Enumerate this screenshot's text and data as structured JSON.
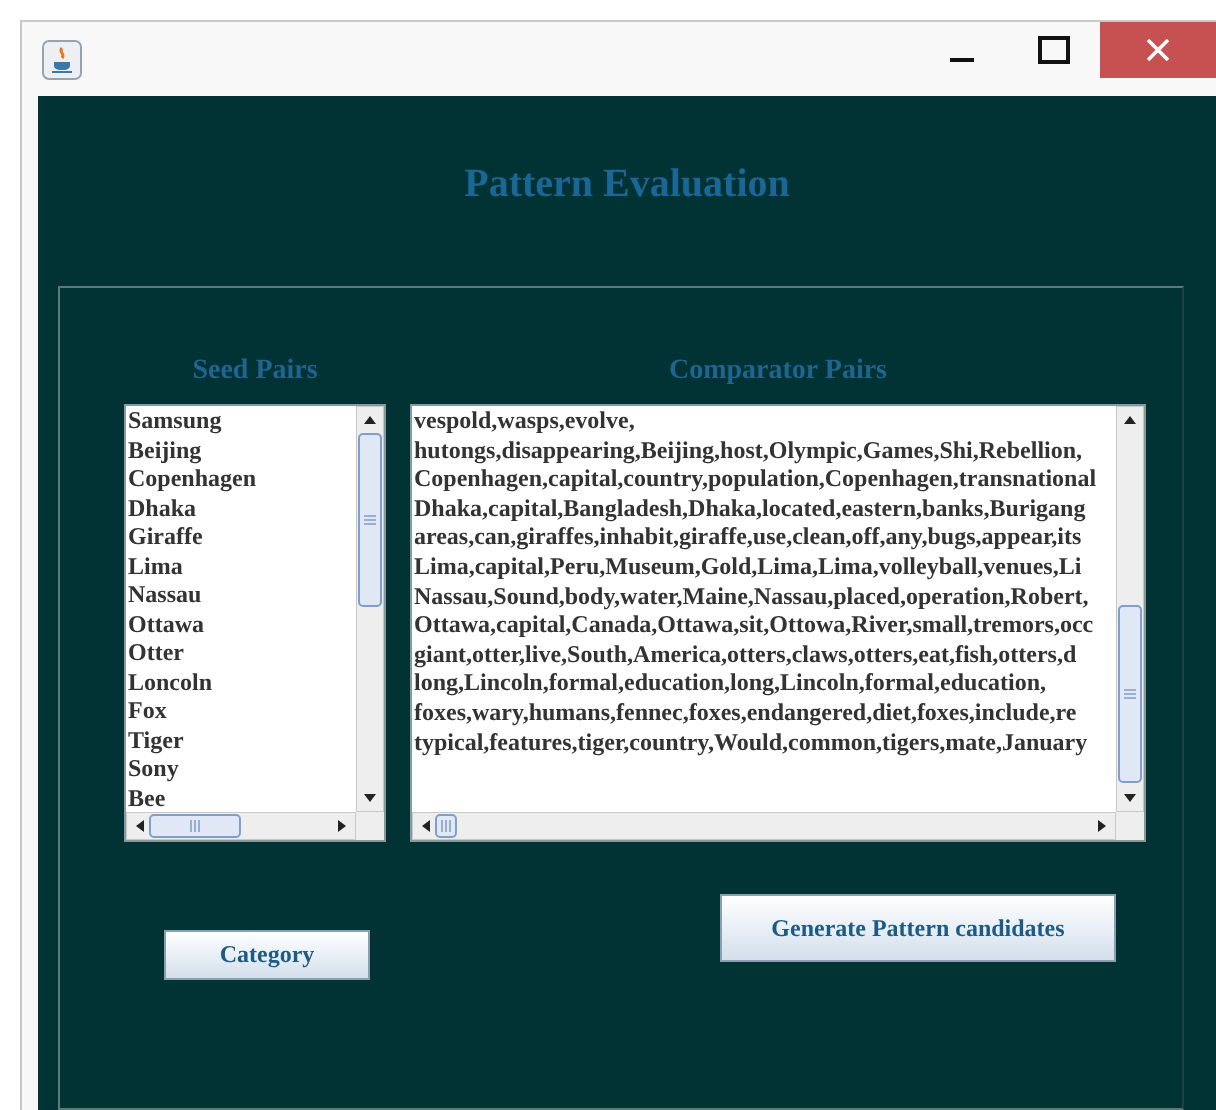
{
  "window": {
    "title": "Pattern Evaluation"
  },
  "seed_pairs": {
    "label": "Seed Pairs",
    "items": [
      "Samsung",
      "Beijing",
      "Copenhagen",
      "Dhaka",
      "Giraffe",
      "Lima",
      "Nassau",
      "Ottawa",
      "Otter",
      "Loncoln",
      "Fox",
      "Tiger",
      "Sony",
      "Bee"
    ]
  },
  "comparator_pairs": {
    "label": "Comparator Pairs",
    "lines": [
      "vespold,wasps,evolve,",
      "hutongs,disappearing,Beijing,host,Olympic,Games,Shi,Rebellion,",
      "Copenhagen,capital,country,population,Copenhagen,transnational",
      "Dhaka,capital,Bangladesh,Dhaka,located,eastern,banks,Burigang",
      "areas,can,giraffes,inhabit,giraffe,use,clean,off,any,bugs,appear,its",
      "Lima,capital,Peru,Museum,Gold,Lima,Lima,volleyball,venues,Li",
      "Nassau,Sound,body,water,Maine,Nassau,placed,operation,Robert,",
      "Ottawa,capital,Canada,Ottawa,sit,Ottowa,River,small,tremors,occ",
      "giant,otter,live,South,America,otters,claws,otters,eat,fish,otters,d",
      "long,Lincoln,formal,education,long,Lincoln,formal,education,",
      "foxes,wary,humans,fennec,foxes,endangered,diet,foxes,include,re",
      "typical,features,tiger,country,Would,common,tigers,mate,January"
    ]
  },
  "buttons": [
    "Category",
    "Generate Pattern candidates"
  ]
}
